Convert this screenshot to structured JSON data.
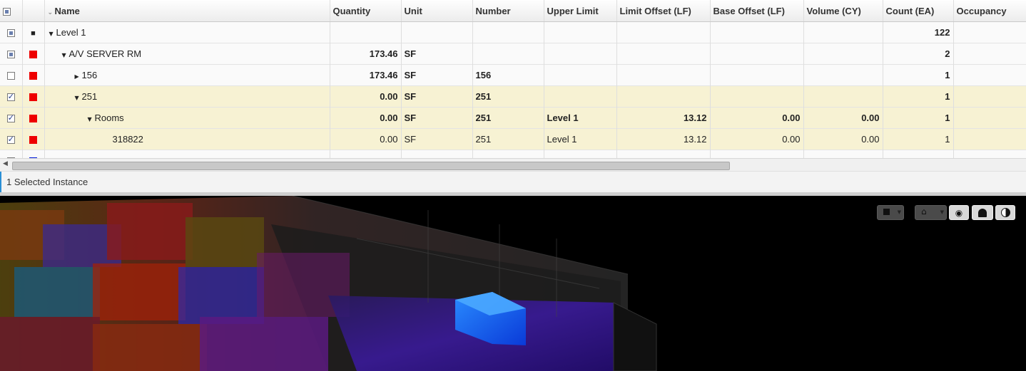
{
  "columns": {
    "name": "Name",
    "quantity": "Quantity",
    "unit": "Unit",
    "number": "Number",
    "upper_limit": "Upper Limit",
    "limit_offset": "Limit Offset (LF)",
    "base_offset": "Base Offset (LF)",
    "volume": "Volume (CY)",
    "count": "Count (EA)",
    "occupancy": "Occupancy"
  },
  "rows": [
    {
      "name": "Level 1",
      "quantity": "",
      "unit": "",
      "number": "",
      "upper_limit": "",
      "limit_offset": "",
      "base_offset": "",
      "volume": "",
      "count": "122",
      "occupancy": ""
    },
    {
      "name": "A/V SERVER RM",
      "quantity": "173.46",
      "unit": "SF",
      "number": "",
      "upper_limit": "",
      "limit_offset": "",
      "base_offset": "",
      "volume": "",
      "count": "2",
      "occupancy": ""
    },
    {
      "name": "156",
      "quantity": "173.46",
      "unit": "SF",
      "number": "156",
      "upper_limit": "",
      "limit_offset": "",
      "base_offset": "",
      "volume": "",
      "count": "1",
      "occupancy": ""
    },
    {
      "name": "251",
      "quantity": "0.00",
      "unit": "SF",
      "number": "251",
      "upper_limit": "",
      "limit_offset": "",
      "base_offset": "",
      "volume": "",
      "count": "1",
      "occupancy": ""
    },
    {
      "name": "Rooms",
      "quantity": "0.00",
      "unit": "SF",
      "number": "251",
      "upper_limit": "Level 1",
      "limit_offset": "13.12",
      "base_offset": "0.00",
      "volume": "0.00",
      "count": "1",
      "occupancy": ""
    },
    {
      "name": "318822",
      "quantity": "0.00",
      "unit": "SF",
      "number": "251",
      "upper_limit": "Level 1",
      "limit_offset": "13.12",
      "base_offset": "0.00",
      "volume": "0.00",
      "count": "1",
      "occupancy": ""
    }
  ],
  "status_text": "1 Selected Instance",
  "colors": {
    "swatch_red": "#ee0000",
    "swatch_blue": "#0018d8",
    "selected_row": "#f7f2d3",
    "highlight_box": "#1a6cff"
  },
  "viewer_toolbar": [
    {
      "icon": "stop-square-icon"
    },
    {
      "icon": "home-icon"
    },
    {
      "icon": "eye-icon"
    },
    {
      "icon": "ghost-icon"
    },
    {
      "icon": "contrast-icon"
    }
  ]
}
